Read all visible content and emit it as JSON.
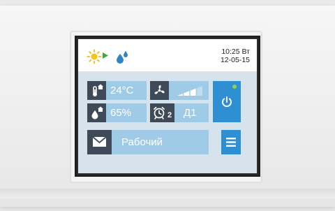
{
  "status": {
    "time_day": "10:25 Вт",
    "date": "12-05-15",
    "mode_icons": [
      "sun-icon",
      "play-arrow-icon",
      "water-drops-icon"
    ]
  },
  "tiles": {
    "temperature": {
      "icon": "thermometer-house-icon",
      "value": "24°C"
    },
    "fan": {
      "icon": "fan-icon",
      "level_icon": "signal-bars-icon",
      "level_fraction": 0.75
    },
    "humidity": {
      "icon": "humidity-house-icon",
      "value": "65%"
    },
    "schedule": {
      "icon": "alarm-clock-icon",
      "subscript": "2",
      "value": "Д1"
    },
    "mode": {
      "icon": "envelope-icon",
      "value": "Рабочий"
    }
  },
  "buttons": {
    "power": {
      "icon": "power-icon",
      "indicator_color": "#8ed14a"
    },
    "menu": {
      "icon": "menu-icon"
    }
  },
  "colors": {
    "tile_bg": "#9fcbe7",
    "icon_bg": "#3f4a58",
    "button_blue": "#2f8fd3",
    "panel_bg": "#d6e3ec"
  }
}
